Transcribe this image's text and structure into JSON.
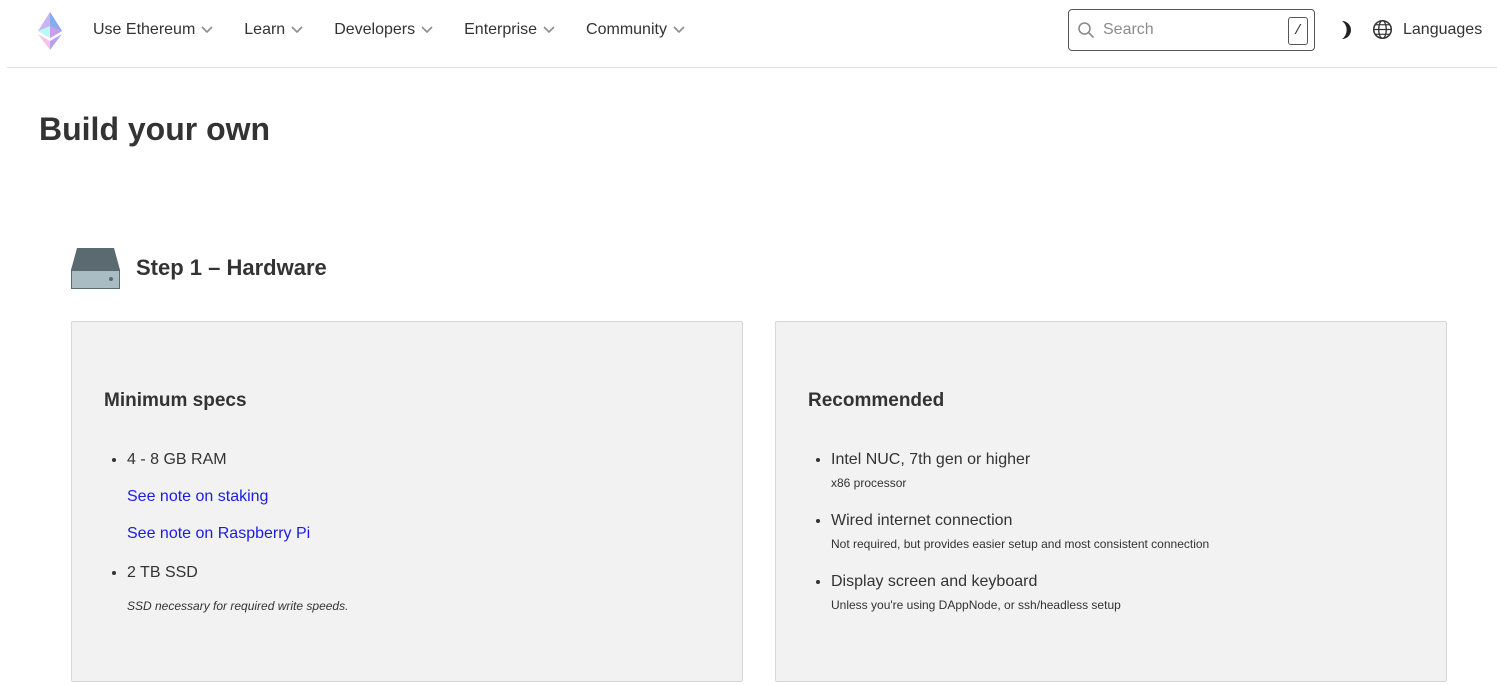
{
  "header": {
    "nav": [
      {
        "label": "Use Ethereum"
      },
      {
        "label": "Learn"
      },
      {
        "label": "Developers"
      },
      {
        "label": "Enterprise"
      },
      {
        "label": "Community"
      }
    ],
    "search": {
      "placeholder": "Search",
      "shortcut": "/"
    },
    "languages_label": "Languages"
  },
  "main": {
    "title": "Build your own",
    "step": {
      "title": "Step 1 – Hardware"
    },
    "minimum": {
      "heading": "Minimum specs",
      "ram": "4 - 8 GB RAM",
      "staking_link": "See note on staking",
      "rpi_link": "See note on Raspberry Pi",
      "ssd": "2 TB SSD",
      "ssd_note": "SSD necessary for required write speeds."
    },
    "recommended": {
      "heading": "Recommended",
      "items": [
        {
          "label": "Intel NUC, 7th gen or higher",
          "sub": "x86 processor"
        },
        {
          "label": "Wired internet connection",
          "sub": "Not required, but provides easier setup and most consistent connection"
        },
        {
          "label": "Display screen and keyboard",
          "sub": "Unless you're using DAppNode, or ssh/headless setup"
        }
      ]
    }
  },
  "icons": {
    "logo": "ethereum-logo",
    "search": "search-icon",
    "theme": "moon-icon",
    "languages": "globe-icon",
    "step": "hard-drive-icon",
    "chevron": "chevron-down-icon"
  },
  "colors": {
    "link": "#1c1ce1",
    "card_bg": "#f2f2f2",
    "text": "#333333"
  }
}
